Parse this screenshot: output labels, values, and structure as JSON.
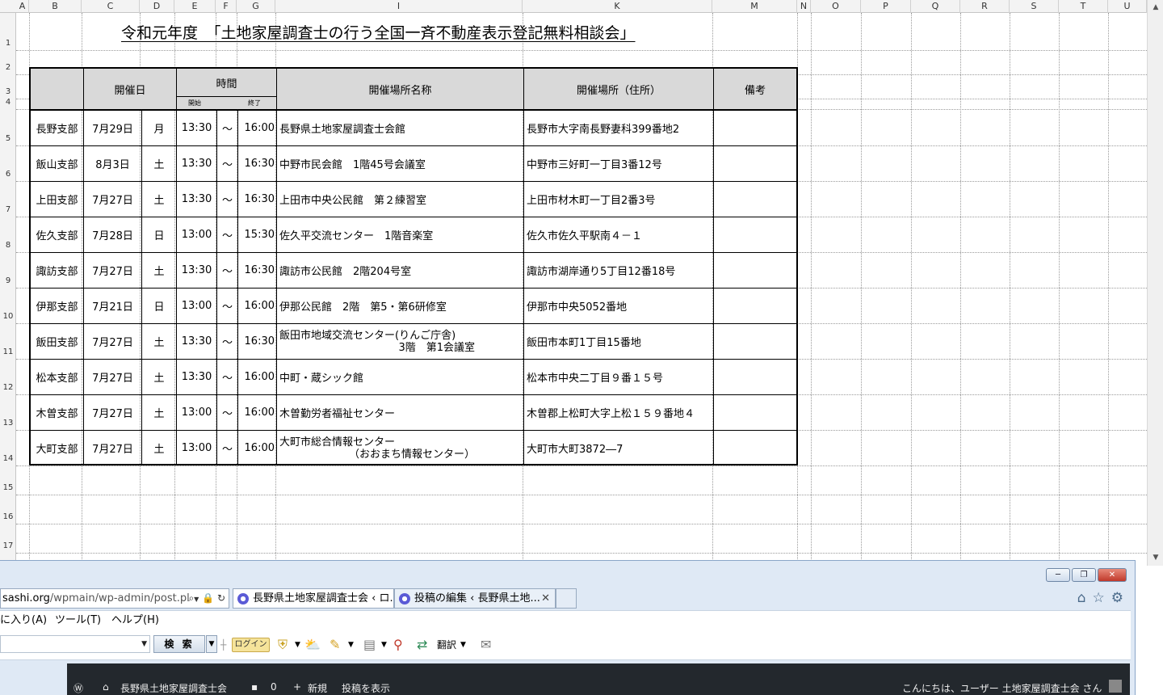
{
  "sheet": {
    "columns": [
      "A",
      "B",
      "C",
      "D",
      "E",
      "F",
      "G",
      "I",
      "K",
      "M",
      "N",
      "O",
      "P",
      "Q",
      "R",
      "S",
      "T",
      "U"
    ],
    "rows": [
      "1",
      "2",
      "3",
      "4",
      "5",
      "6",
      "7",
      "8",
      "9",
      "10",
      "11",
      "12",
      "13",
      "14",
      "15",
      "16",
      "17"
    ],
    "title": "令和元年度　「土地家屋調査士の行う全国一斉不動産表示登記無料相談会」",
    "table": {
      "headers": {
        "date": "開催日",
        "time": "時間",
        "start": "開始",
        "end": "終了",
        "venue_name": "開催場所名称",
        "venue_address": "開催場所（住所）",
        "notes": "備考"
      },
      "rows": [
        {
          "branch": "長野支部",
          "date": "7月29日",
          "dow": "月",
          "start": "13:30",
          "sep": "～",
          "end": "16:00",
          "venue": [
            "長野県土地家屋調査士会館"
          ],
          "address": "長野市大字南長野妻科399番地2",
          "notes": ""
        },
        {
          "branch": "飯山支部",
          "date": "8月3日",
          "dow": "土",
          "start": "13:30",
          "sep": "～",
          "end": "16:30",
          "venue": [
            "中野市民会館　1階45号会議室"
          ],
          "address": "中野市三好町一丁目3番12号",
          "notes": ""
        },
        {
          "branch": "上田支部",
          "date": "7月27日",
          "dow": "土",
          "start": "13:30",
          "sep": "～",
          "end": "16:30",
          "venue": [
            "上田市中央公民館　第２練習室"
          ],
          "address": "上田市材木町一丁目2番3号",
          "notes": ""
        },
        {
          "branch": "佐久支部",
          "date": "7月28日",
          "dow": "日",
          "start": "13:00",
          "sep": "～",
          "end": "15:30",
          "venue": [
            "佐久平交流センター　1階音楽室"
          ],
          "address": "佐久市佐久平駅南４－１",
          "notes": ""
        },
        {
          "branch": "諏訪支部",
          "date": "7月27日",
          "dow": "土",
          "start": "13:30",
          "sep": "～",
          "end": "16:30",
          "venue": [
            "諏訪市公民館　2階204号室"
          ],
          "address": "諏訪市湖岸通り5丁目12番18号",
          "notes": ""
        },
        {
          "branch": "伊那支部",
          "date": "7月21日",
          "dow": "日",
          "start": "13:00",
          "sep": "～",
          "end": "16:00",
          "venue": [
            "伊那公民館　2階　第5・第6研修室"
          ],
          "address": "伊那市中央5052番地",
          "notes": ""
        },
        {
          "branch": "飯田支部",
          "date": "7月27日",
          "dow": "土",
          "start": "13:30",
          "sep": "～",
          "end": "16:30",
          "venue": [
            "飯田市地域交流センター(りんご庁舎)",
            "3階　第1会議室"
          ],
          "address": "飯田市本町1丁目15番地",
          "notes": ""
        },
        {
          "branch": "松本支部",
          "date": "7月27日",
          "dow": "土",
          "start": "13:30",
          "sep": "～",
          "end": "16:00",
          "venue": [
            "中町・蔵シック館"
          ],
          "address": "松本市中央二丁目９番１５号",
          "notes": ""
        },
        {
          "branch": "木曽支部",
          "date": "7月27日",
          "dow": "土",
          "start": "13:00",
          "sep": "～",
          "end": "16:00",
          "venue": [
            "木曽勤労者福祉センター"
          ],
          "address": "木曽郡上松町大字上松１５９番地４",
          "notes": ""
        },
        {
          "branch": "大町支部",
          "date": "7月27日",
          "dow": "土",
          "start": "13:00",
          "sep": "～",
          "end": "16:00",
          "venue": [
            "大町市総合情報センター",
            "（おおまち情報センター）"
          ],
          "address": "大町市大町3872―7",
          "notes": ""
        }
      ]
    }
  },
  "browser": {
    "address_host": "sashi.org",
    "address_path": "/wpmain/wp-admin/post.pl",
    "tabs": [
      {
        "label": "長野県土地家屋調査士会 ‹ ロ..."
      },
      {
        "label": "投稿の編集 ‹ 長野県土地..."
      }
    ],
    "window_buttons": {
      "minimize": "─",
      "restore": "❐",
      "close": "✕"
    },
    "menu": [
      "に入り(A)",
      "ツール(T)",
      "ヘルプ(H)"
    ],
    "toolbar": {
      "search_button": "検 索",
      "login_button": "ログイン",
      "translate": "翻訳"
    },
    "wpbar": {
      "site": "長野県土地家屋調査士会",
      "comments": "0",
      "new": "新規",
      "view": "投稿を表示",
      "greeting": "こんにちは、ユーザー 土地家屋調査士会 さん"
    }
  }
}
